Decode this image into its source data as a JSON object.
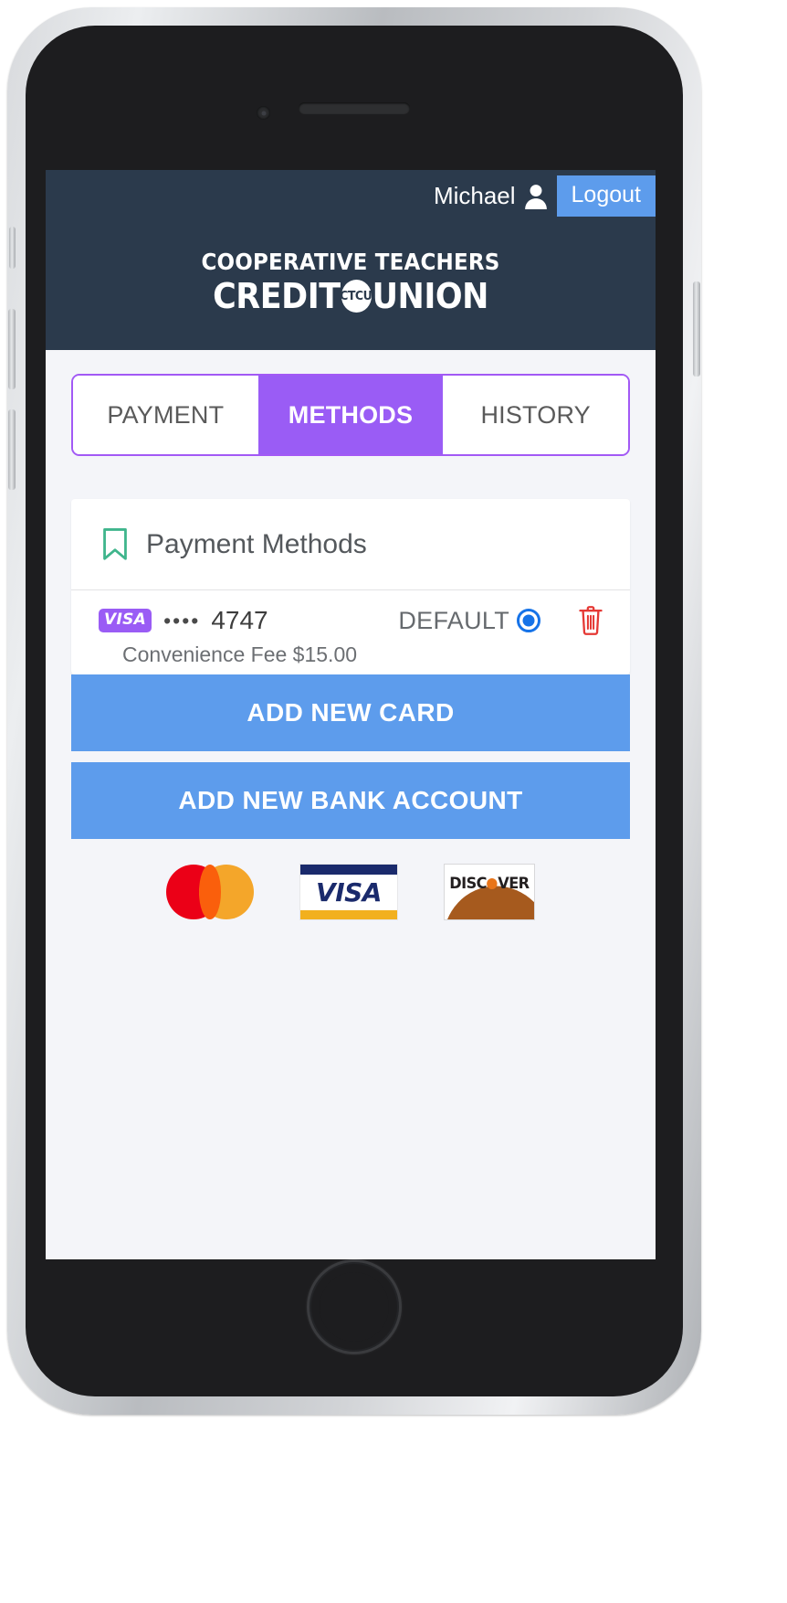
{
  "header": {
    "user_name": "Michael",
    "user_icon": "person-icon",
    "logout_label": "Logout",
    "logo_line1": "COOPERATIVE TEACHERS",
    "logo_credit": "CREDIT",
    "logo_badge": "CTCU",
    "logo_union": "UNION",
    "background_color": "#2b3a4c"
  },
  "tabs": {
    "accent_color": "#9a5cf5",
    "items": [
      {
        "label": "PAYMENT",
        "active": false
      },
      {
        "label": "METHODS",
        "active": true
      },
      {
        "label": "HISTORY",
        "active": false
      }
    ]
  },
  "payment_methods_card": {
    "icon": "bookmark-icon",
    "icon_color": "#3fb58c",
    "title": "Payment Methods",
    "methods": [
      {
        "brand": "VISA",
        "brand_color": "#9a5cf5",
        "masked_dots": "••••",
        "last4": "4747",
        "default_label": "DEFAULT",
        "is_default": true,
        "default_radio_color": "#1673e8",
        "delete_icon": "trash-icon",
        "delete_icon_color": "#e53935",
        "fee_text": "Convenience Fee $15.00"
      }
    ]
  },
  "actions": {
    "button_color": "#5d9cec",
    "add_card_label": "ADD NEW CARD",
    "add_bank_label": "ADD NEW BANK ACCOUNT"
  },
  "accepted_brands": {
    "mastercard": {
      "name": "mastercard-logo",
      "color_left": "#eb0017",
      "color_right": "#f4a62a"
    },
    "visa": {
      "name": "visa-logo",
      "text": "VISA",
      "bar_top_color": "#1a2a6c",
      "bar_bottom_color": "#f2b01e"
    },
    "discover": {
      "name": "discover-logo",
      "text_before": "DISC",
      "text_after": "VER",
      "accent_color": "#e8751a"
    }
  }
}
